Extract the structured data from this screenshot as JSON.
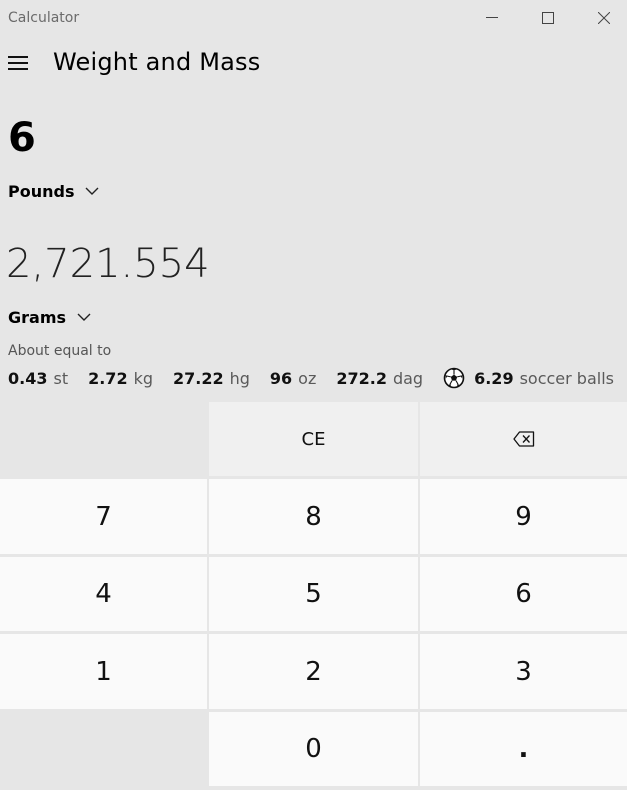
{
  "window": {
    "title": "Calculator"
  },
  "header": {
    "title": "Weight and Mass",
    "menu_icon": "hamburger-icon"
  },
  "converter": {
    "input_value": "6",
    "from_unit": "Pounds",
    "output_value": "2,721.554",
    "to_unit": "Grams",
    "about_label": "About equal to",
    "equivalents": [
      {
        "value": "0.43",
        "unit": "st"
      },
      {
        "value": "2.72",
        "unit": "kg"
      },
      {
        "value": "27.22",
        "unit": "hg"
      },
      {
        "value": "96",
        "unit": "oz"
      },
      {
        "value": "272.2",
        "unit": "dag"
      },
      {
        "value": "6.29",
        "unit": "soccer balls",
        "icon": "soccer-ball-icon"
      }
    ]
  },
  "keypad": {
    "ce": "CE",
    "backspace_icon": "backspace-icon",
    "seven": "7",
    "eight": "8",
    "nine": "9",
    "four": "4",
    "five": "5",
    "six": "6",
    "one": "1",
    "two": "2",
    "three": "3",
    "zero": "0",
    "decimal": "."
  }
}
